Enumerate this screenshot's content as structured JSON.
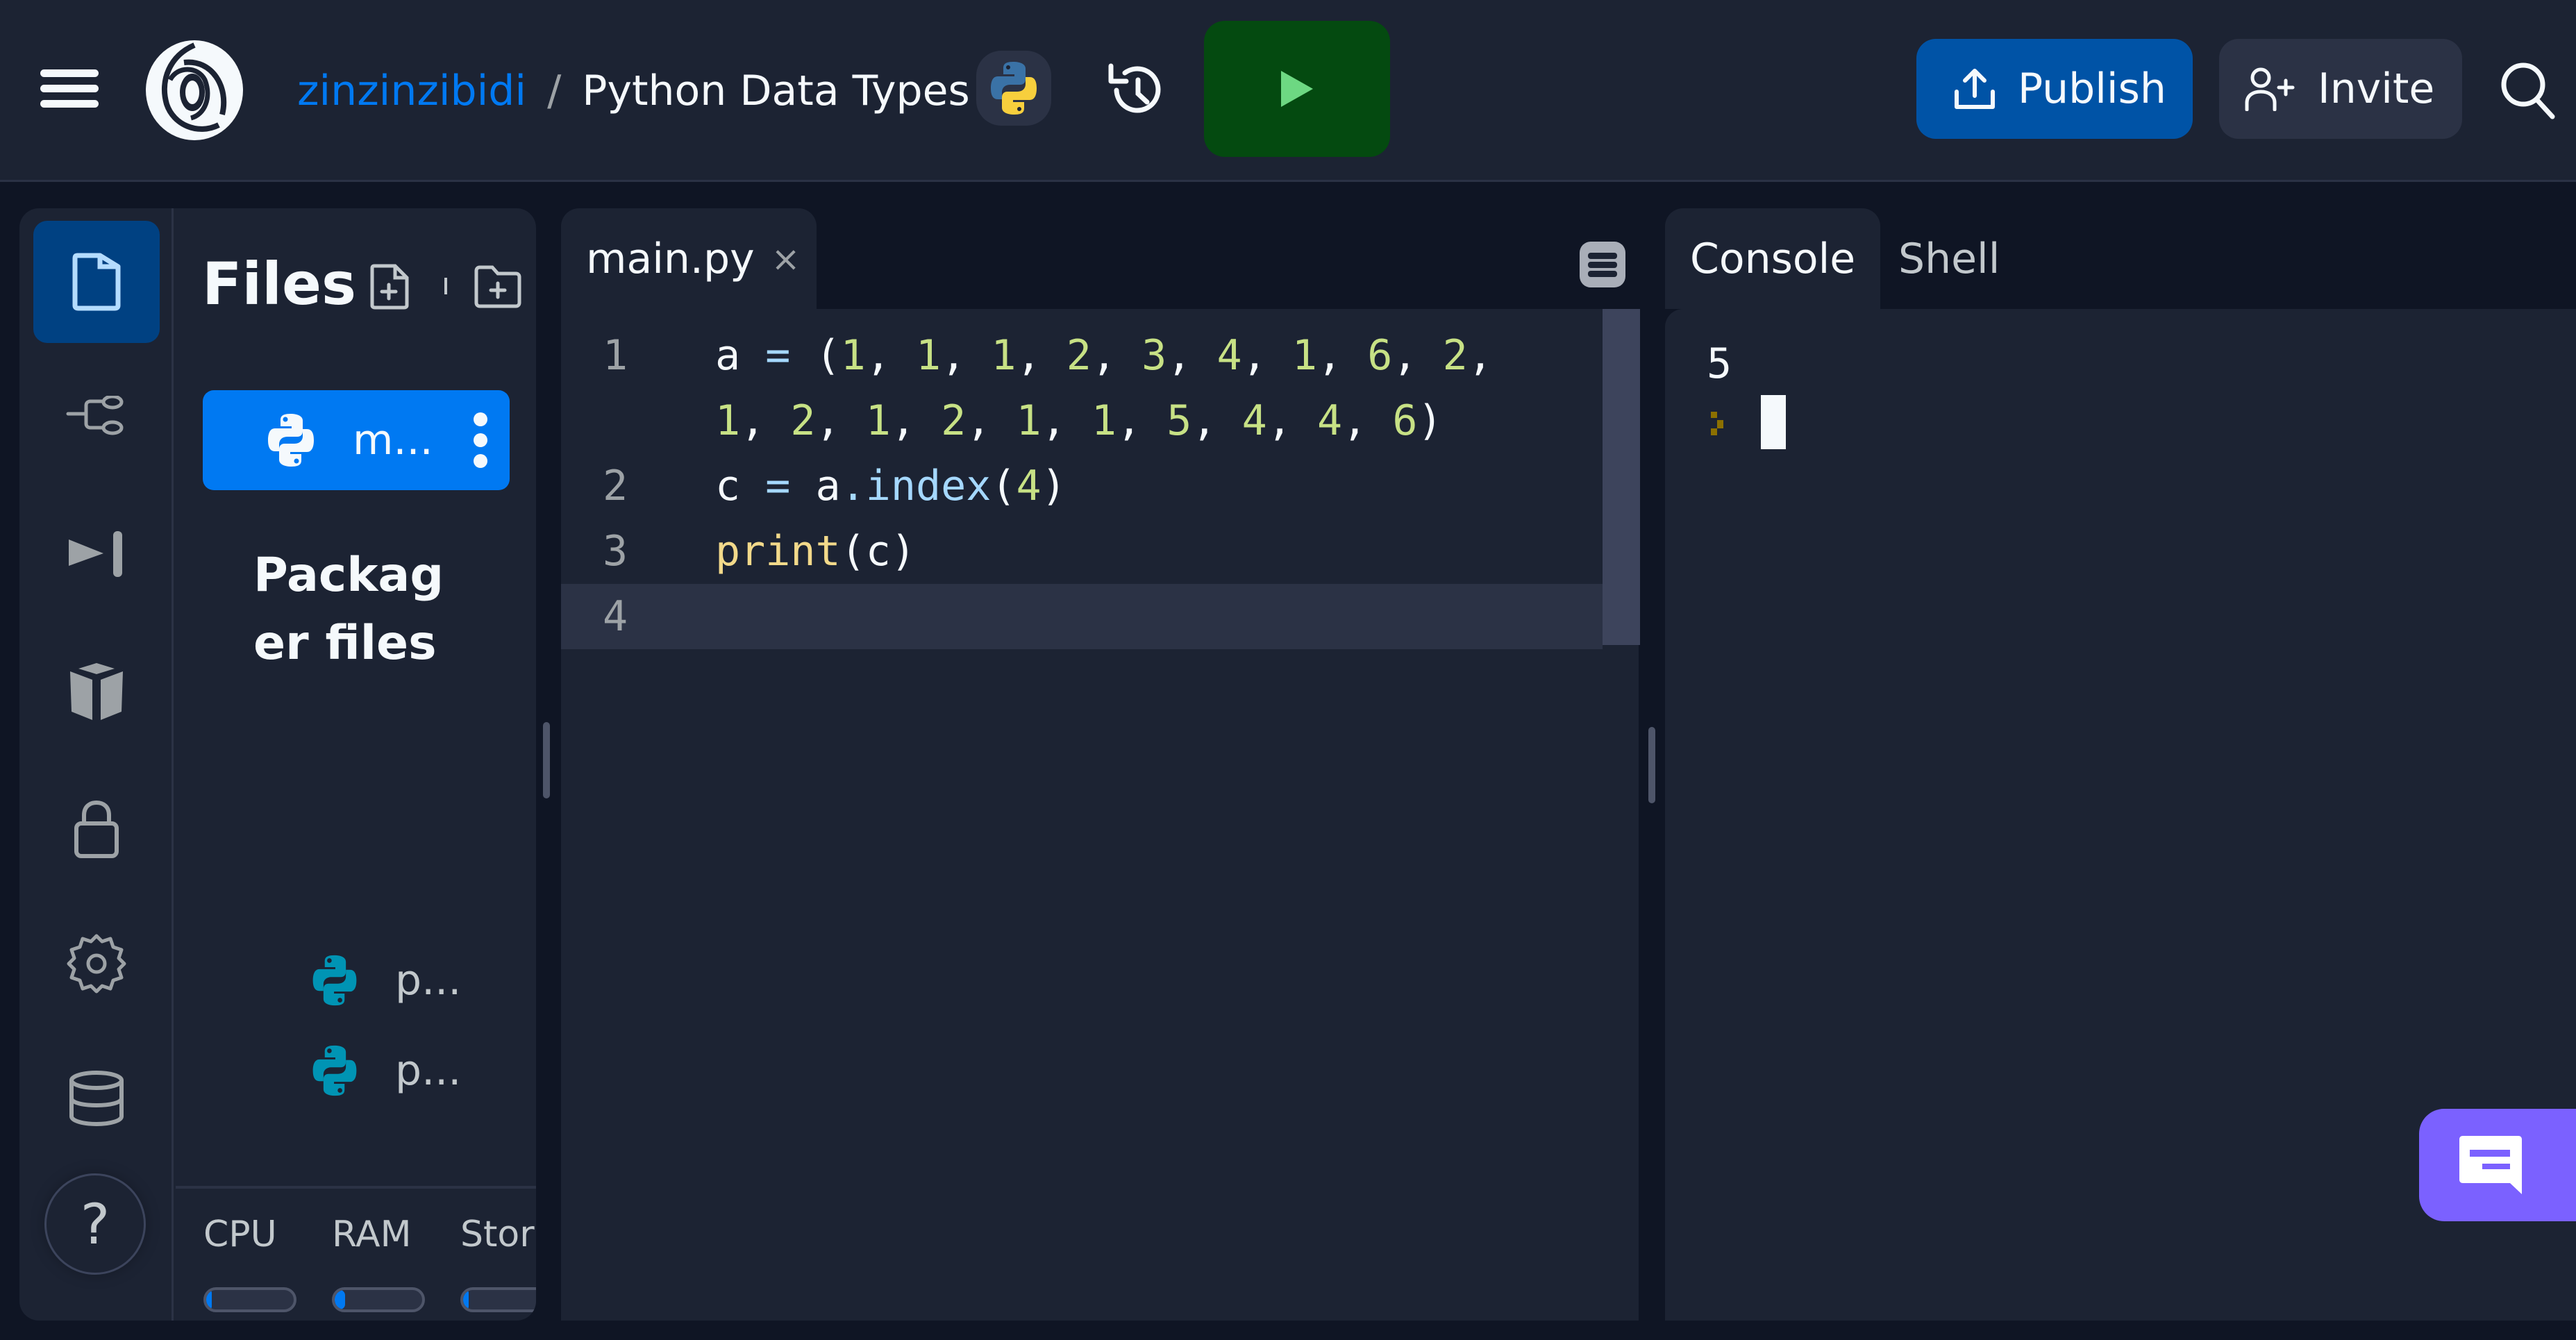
{
  "header": {
    "username": "zinzinzibidi",
    "separator": "/",
    "repl_title": "Python Data Types",
    "language": "python",
    "run_icon": "play-icon",
    "history_icon": "history-icon",
    "publish_label": "Publish",
    "invite_label": "Invite",
    "search_icon": "search-icon"
  },
  "nav_rail": {
    "items": [
      {
        "name": "files",
        "icon": "file-icon",
        "active": true
      },
      {
        "name": "git",
        "icon": "version-control-icon",
        "active": false
      },
      {
        "name": "debugger",
        "icon": "step-forward-icon",
        "active": false
      },
      {
        "name": "packages",
        "icon": "cube-icon",
        "active": false
      },
      {
        "name": "secrets",
        "icon": "lock-icon",
        "active": false
      },
      {
        "name": "settings",
        "icon": "gear-icon",
        "active": false
      },
      {
        "name": "database",
        "icon": "database-icon",
        "active": false
      }
    ],
    "help_label": "?"
  },
  "files_panel": {
    "title": "Files",
    "active_file": "m...",
    "section_title": "Packager files",
    "package_files": [
      "p...",
      "p..."
    ],
    "resources": [
      {
        "label": "CPU",
        "usage": 0.02
      },
      {
        "label": "RAM",
        "usage": 0.12
      },
      {
        "label": "Stor",
        "usage": 0.02
      }
    ]
  },
  "editor": {
    "tab_label": "main.py",
    "tab_close": "×",
    "lines": [
      {
        "n": "1",
        "wrap": [
          "a = (1, 1, 1, 2, 3, 4, 1, 6, 2,",
          "1, 2, 1, 2, 1, 1, 5, 4, 4, 6)"
        ]
      },
      {
        "n": "2",
        "text": "c = a.index(4)"
      },
      {
        "n": "3",
        "text": "print(c)"
      },
      {
        "n": "4",
        "text": ""
      }
    ],
    "active_line": 4
  },
  "console_pane": {
    "tabs": [
      {
        "label": "Console",
        "active": true
      },
      {
        "label": "Shell",
        "active": false
      }
    ],
    "output": "5"
  },
  "colors": {
    "accent": "#0079f2",
    "run_bg": "#044a10",
    "run_icon": "#6dd882",
    "publish_bg": "#0053a6",
    "chat_bg": "#7b61ff",
    "prompt": "#8c7000"
  }
}
